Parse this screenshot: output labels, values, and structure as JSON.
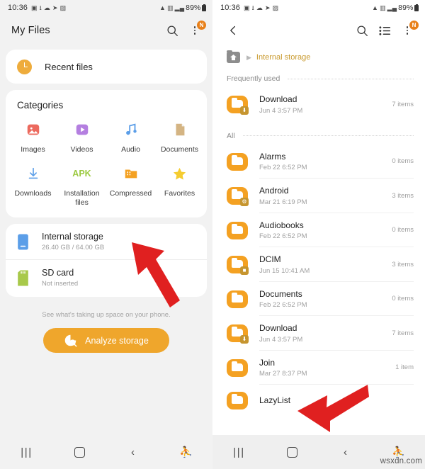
{
  "status_bar": {
    "time": "10:36",
    "left_icons": [
      "message-icon",
      "download-icon",
      "cloud-icon",
      "telegram-icon",
      "image-icon"
    ],
    "right_icons": [
      "wifi-icon",
      "vowifi-icon",
      "signal-icon"
    ],
    "battery": "89%"
  },
  "left_screen": {
    "app_bar": {
      "title": "My Files",
      "search": "search-icon",
      "overflow_badge": "N"
    },
    "recent": {
      "label": "Recent files",
      "icon": "clock-icon"
    },
    "categories": {
      "title": "Categories",
      "items": [
        {
          "label": "Images",
          "icon": "image-icon",
          "color": "#ec6a5e"
        },
        {
          "label": "Videos",
          "icon": "video-icon",
          "color": "#b47fe0"
        },
        {
          "label": "Audio",
          "icon": "audio-icon",
          "color": "#5b9ee8"
        },
        {
          "label": "Documents",
          "icon": "document-icon",
          "color": "#d4b483"
        },
        {
          "label": "Downloads",
          "icon": "download-icon",
          "color": "#5b9ee8"
        },
        {
          "label": "Installation files",
          "icon": "apk-icon",
          "color": "#9bc93f"
        },
        {
          "label": "Compressed",
          "icon": "zip-folder-icon",
          "color": "#f4a122"
        },
        {
          "label": "Favorites",
          "icon": "star-icon",
          "color": "#f5cc30"
        }
      ]
    },
    "storage": [
      {
        "name": "Internal storage",
        "sub": "26.40 GB / 64.00 GB",
        "icon": "phone-icon",
        "color": "#5b9ee8"
      },
      {
        "name": "SD card",
        "sub": "Not inserted",
        "icon": "sdcard-icon",
        "color": "#a8c94a"
      }
    ],
    "analyze": {
      "hint": "See what's taking up space on your phone.",
      "button": "Analyze storage",
      "icon": "analyze-icon",
      "color": "#efa62c"
    }
  },
  "right_screen": {
    "app_bar": {
      "back": "back-icon",
      "search": "search-icon",
      "view": "list-view-icon",
      "overflow_badge": "N"
    },
    "breadcrumb": {
      "home": "home-icon",
      "arrow": "▶",
      "path": "Internal storage"
    },
    "sections": [
      {
        "title": "Frequently used",
        "files": [
          {
            "name": "Download",
            "date": "Jun 4 3:57 PM",
            "count": "7 items",
            "badge": "⬇"
          }
        ]
      },
      {
        "title": "All",
        "files": [
          {
            "name": "Alarms",
            "date": "Feb 22 6:52 PM",
            "count": "0 items",
            "badge": ""
          },
          {
            "name": "Android",
            "date": "Mar 21 6:19 PM",
            "count": "3 items",
            "badge": "⚙"
          },
          {
            "name": "Audiobooks",
            "date": "Feb 22 6:52 PM",
            "count": "0 items",
            "badge": ""
          },
          {
            "name": "DCIM",
            "date": "Jun 15 10:41 AM",
            "count": "3 items",
            "badge": "■"
          },
          {
            "name": "Documents",
            "date": "Feb 22 6:52 PM",
            "count": "0 items",
            "badge": ""
          },
          {
            "name": "Download",
            "date": "Jun 4 3:57 PM",
            "count": "7 items",
            "badge": "⬇"
          },
          {
            "name": "Join",
            "date": "Mar 27 8:37 PM",
            "count": "1 item",
            "badge": ""
          },
          {
            "name": "LazyList",
            "date": "",
            "count": "",
            "badge": ""
          }
        ]
      }
    ]
  },
  "nav_bar": {
    "recents": "|||",
    "home": "home-button",
    "back": "‹",
    "accessibility": "accessibility-icon"
  },
  "watermark": "wsxdn.com",
  "annotations": {
    "arrow_color": "#e02020",
    "arrows": [
      "points-at-internal-storage",
      "points-at-download-folder"
    ]
  }
}
